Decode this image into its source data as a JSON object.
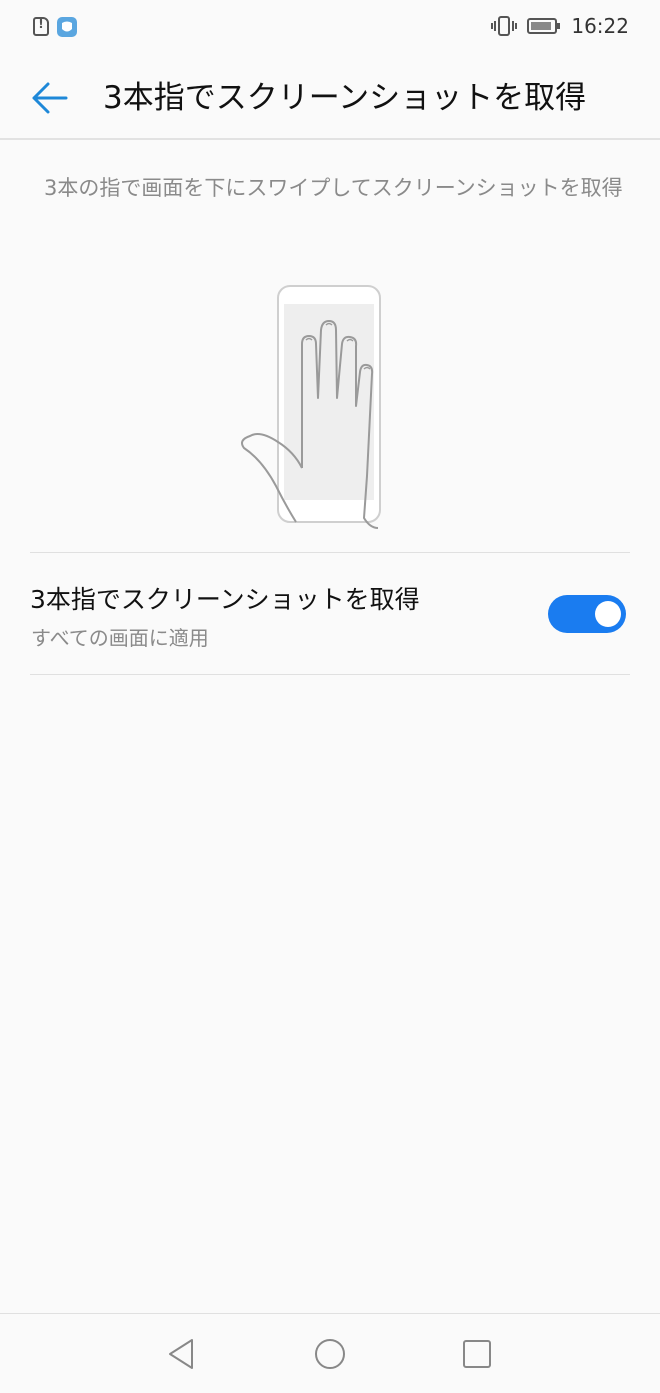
{
  "status_bar": {
    "time": "16:22",
    "icons": [
      "sim-alert-icon",
      "app-notification-icon",
      "vibrate-icon",
      "battery-charging-icon"
    ]
  },
  "app_bar": {
    "title": "3本指でスクリーンショットを取得",
    "back_icon": "arrow-back-icon"
  },
  "description": "3本の指で画面を下にスワイプしてスクリーンショットを取得",
  "setting": {
    "title": "3本指でスクリーンショットを取得",
    "subtitle": "すべての画面に適用",
    "enabled": true
  },
  "nav_bar": {
    "icons": [
      "nav-back-icon",
      "nav-home-icon",
      "nav-recents-icon"
    ]
  },
  "colors": {
    "accent": "#1a7cf0",
    "back_arrow": "#1e88d8",
    "secondary_text": "#8a8a8a",
    "background": "#fafafa"
  }
}
